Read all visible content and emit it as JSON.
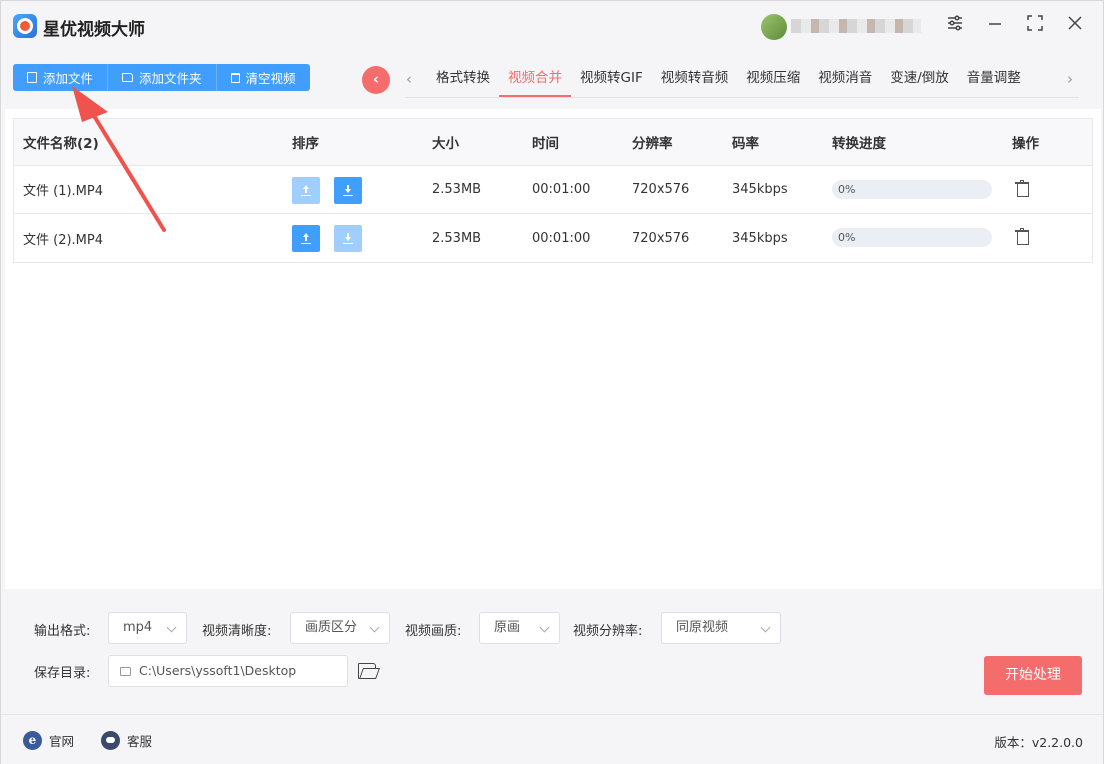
{
  "app": {
    "title": "星优视频大师"
  },
  "toolbar": {
    "add_file": "添加文件",
    "add_folder": "添加文件夹",
    "clear_videos": "清空视频"
  },
  "tabs": [
    {
      "label": "格式转换",
      "active": false
    },
    {
      "label": "视频合并",
      "active": true
    },
    {
      "label": "视频转GIF",
      "active": false
    },
    {
      "label": "视频转音频",
      "active": false
    },
    {
      "label": "视频压缩",
      "active": false
    },
    {
      "label": "视频消音",
      "active": false
    },
    {
      "label": "变速/倒放",
      "active": false
    },
    {
      "label": "音量调整",
      "active": false
    }
  ],
  "table": {
    "headers": {
      "name": "文件名称(2)",
      "sort": "排序",
      "size": "大小",
      "time": "时间",
      "resolution": "分辨率",
      "bitrate": "码率",
      "progress": "转换进度",
      "action": "操作"
    },
    "rows": [
      {
        "name": "文件 (1).MP4",
        "size": "2.53MB",
        "time": "00:01:00",
        "resolution": "720x576",
        "bitrate": "345kbps",
        "progress_text": "0%",
        "progress_value": 0,
        "up_enabled": false,
        "down_enabled": true
      },
      {
        "name": "文件 (2).MP4",
        "size": "2.53MB",
        "time": "00:01:00",
        "resolution": "720x576",
        "bitrate": "345kbps",
        "progress_text": "0%",
        "progress_value": 0,
        "up_enabled": true,
        "down_enabled": false
      }
    ]
  },
  "settings": {
    "output_format_label": "输出格式:",
    "output_format_value": "mp4",
    "clarity_label": "视频清晰度:",
    "clarity_value": "画质区分",
    "quality_label": "视频画质:",
    "quality_value": "原画",
    "resolution_label": "视频分辨率:",
    "resolution_value": "同原视频",
    "save_dir_label": "保存目录:",
    "save_dir_value": "C:\\Users\\yssoft1\\Desktop",
    "start_button": "开始处理"
  },
  "footer": {
    "website": "官网",
    "support": "客服",
    "version": "版本：v2.2.0.0"
  },
  "colors": {
    "primary": "#409eff",
    "accent": "#f56c6c",
    "annotation_arrow": "#f0524d"
  }
}
